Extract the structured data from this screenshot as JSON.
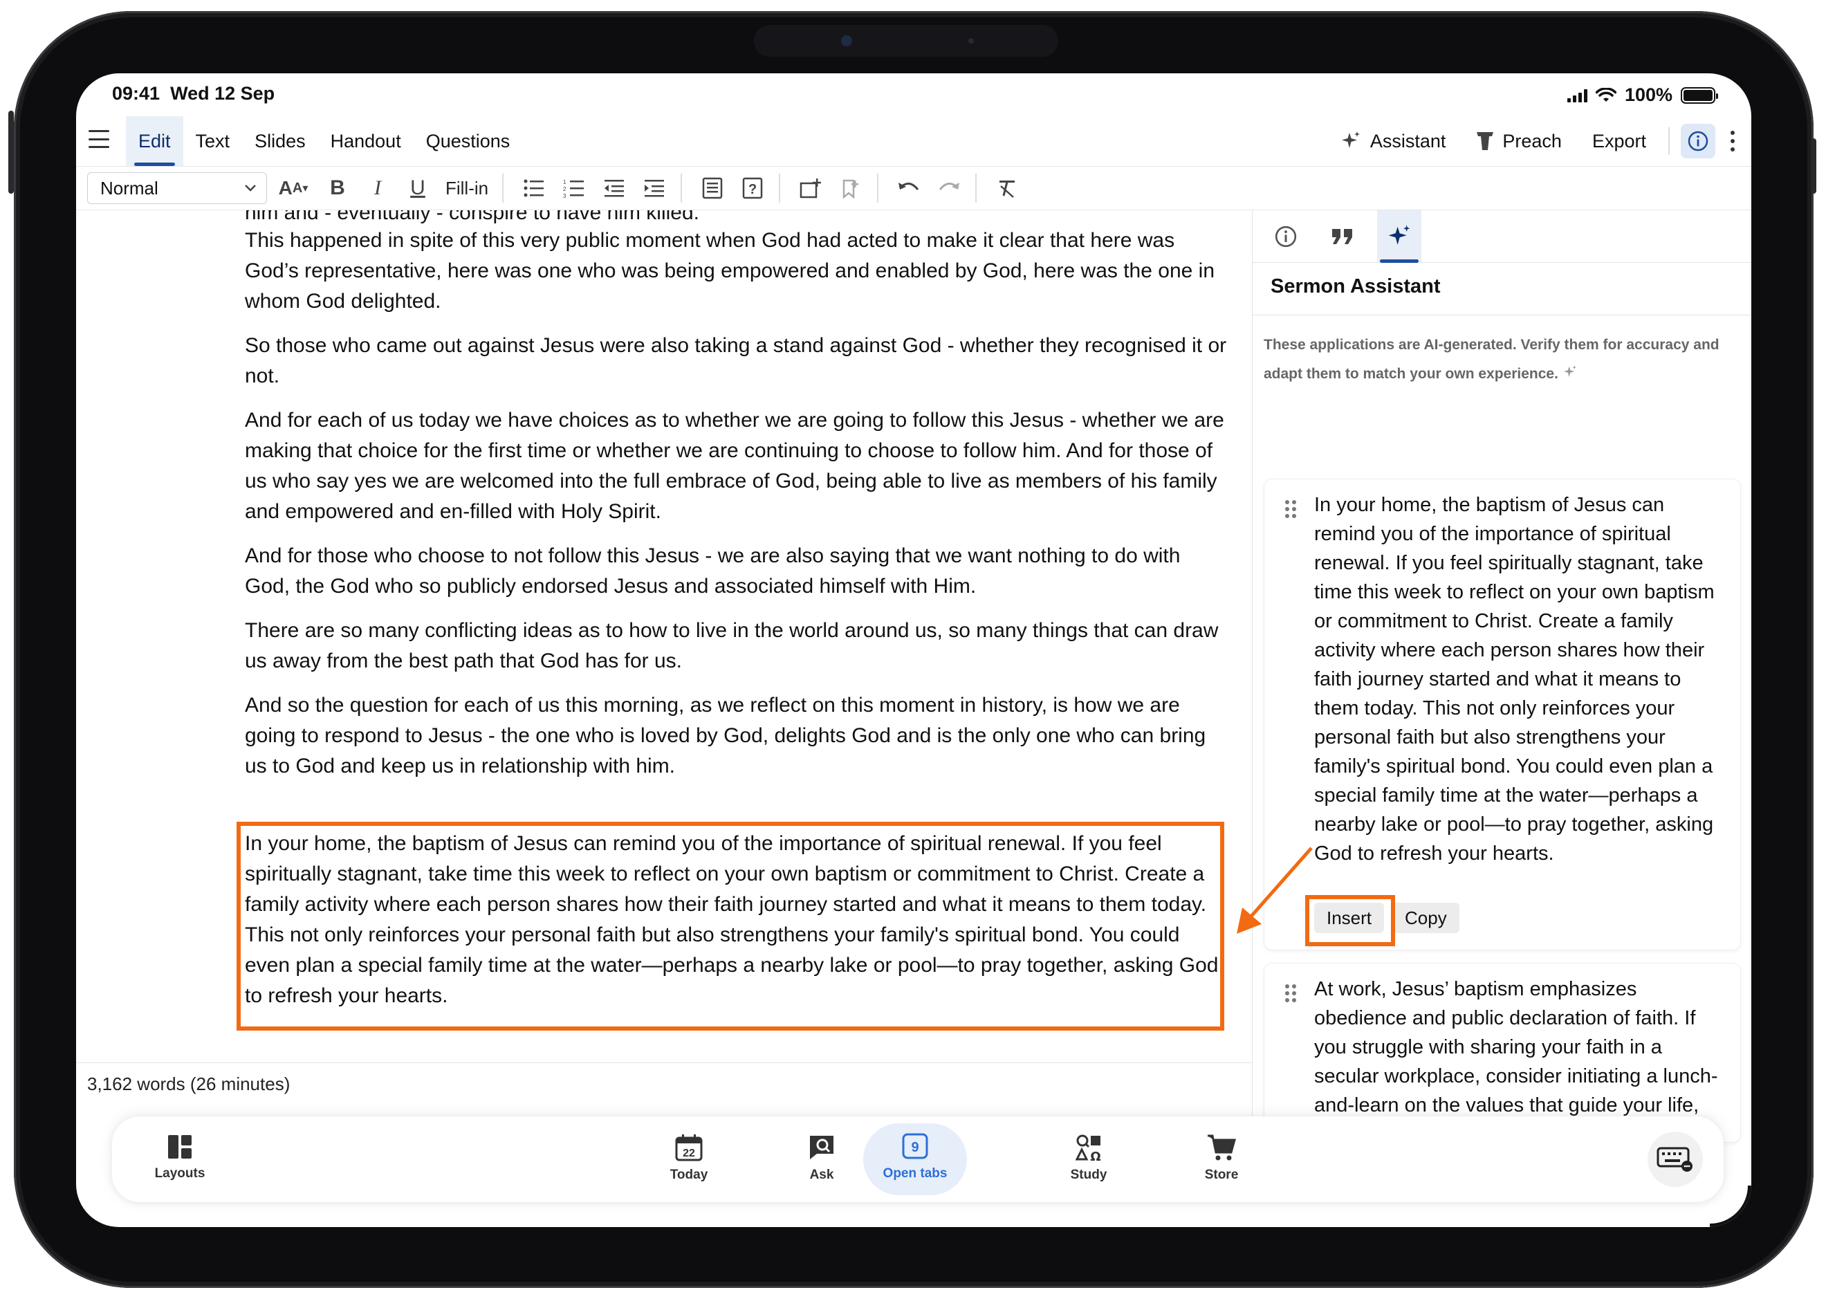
{
  "status": {
    "time": "09:41",
    "date": "Wed 12 Sep",
    "battery": "100%"
  },
  "toolbar": {
    "tabs": [
      {
        "label": "Edit",
        "active": true
      },
      {
        "label": "Text"
      },
      {
        "label": "Slides"
      },
      {
        "label": "Handout"
      },
      {
        "label": "Questions"
      }
    ],
    "assistant_label": "Assistant",
    "preach_label": "Preach",
    "export_label": "Export"
  },
  "format": {
    "style": "Normal",
    "fillin_label": "Fill-in"
  },
  "editor": {
    "paragraphs": [
      "him and - eventually - conspire to have him killed.",
      "This happened in spite of this very public moment when God had acted to make it clear that here was God’s representative, here was one who was being empowered and enabled by God, here was the one in whom God delighted.",
      "So those who came out against Jesus were also taking a stand against God - whether they recognised it or not.",
      "And for each of us today we have choices as to whether we are going to follow this Jesus - whether we are making that choice for the first time or whether we are continuing to choose to follow him. And for those of us who say yes we are welcomed into the full embrace of God, being able to live as members of his family and empowered and en-filled with Holy Spirit.",
      "And for those who choose to not follow this Jesus - we are also saying that we want nothing to do with God, the God who so publicly endorsed Jesus and associated himself with Him.",
      "There are so many conflicting ideas as to how to live in the world around us, so many things that can draw us away from the best path that God has for us.",
      "And so the question for each of us this morning, as we reflect on this moment in history, is how we are going to respond to Jesus - the one who is loved by God, delights God and is the only one who can bring us to God and keep us in relationship with him."
    ],
    "inserted": "In your home, the baptism of Jesus can remind you of the importance of spiritual renewal. If you feel spiritually stagnant, take time this week to reflect on your own baptism or commitment to Christ. Create a family activity where each person shares how their faith journey started and what it means to them today. This not only reinforces your personal faith but also strengthens your family's spiritual bond. You could even plan a special family time at the water—perhaps a nearby lake or pool—to pray together, asking God to refresh your hearts.",
    "word_count": "3,162 words (26 minutes)"
  },
  "sidebar": {
    "title": "Sermon Assistant",
    "disclaimer": "These applications are AI-generated. Verify them for accuracy and adapt them to match your own experience.",
    "cards": [
      {
        "text": "In your home, the baptism of Jesus can remind you of the importance of spiritual renewal. If you feel spiritually stagnant, take time this week to reflect on your own baptism or commitment to Christ. Create a family activity where each person shares how their faith journey started and what it means to them today. This not only reinforces your personal faith but also strengthens your family's spiritual bond. You could even plan a special family time at the water—perhaps a nearby lake or pool—to pray together, asking God to refresh your hearts.",
        "insert_label": "Insert",
        "copy_label": "Copy"
      },
      {
        "text": "At work, Jesus’ baptism emphasizes obedience and public declaration of faith. If you struggle with sharing your faith in a secular workplace, consider initiating a lunch-and-learn on the values that guide your life, including your faith in Jesus. Prepare a short talk about how baptism"
      }
    ]
  },
  "dock": {
    "items": [
      {
        "label": "Layouts"
      },
      {
        "label": "Today",
        "badge": "22"
      },
      {
        "label": "Ask"
      },
      {
        "label": "Open tabs",
        "badge": "9",
        "active": true
      },
      {
        "label": "Study"
      },
      {
        "label": "Store"
      }
    ]
  },
  "colors": {
    "highlight": "#f26a12",
    "accent": "#1d4e9e",
    "active_dock": "#2d6fd6"
  }
}
